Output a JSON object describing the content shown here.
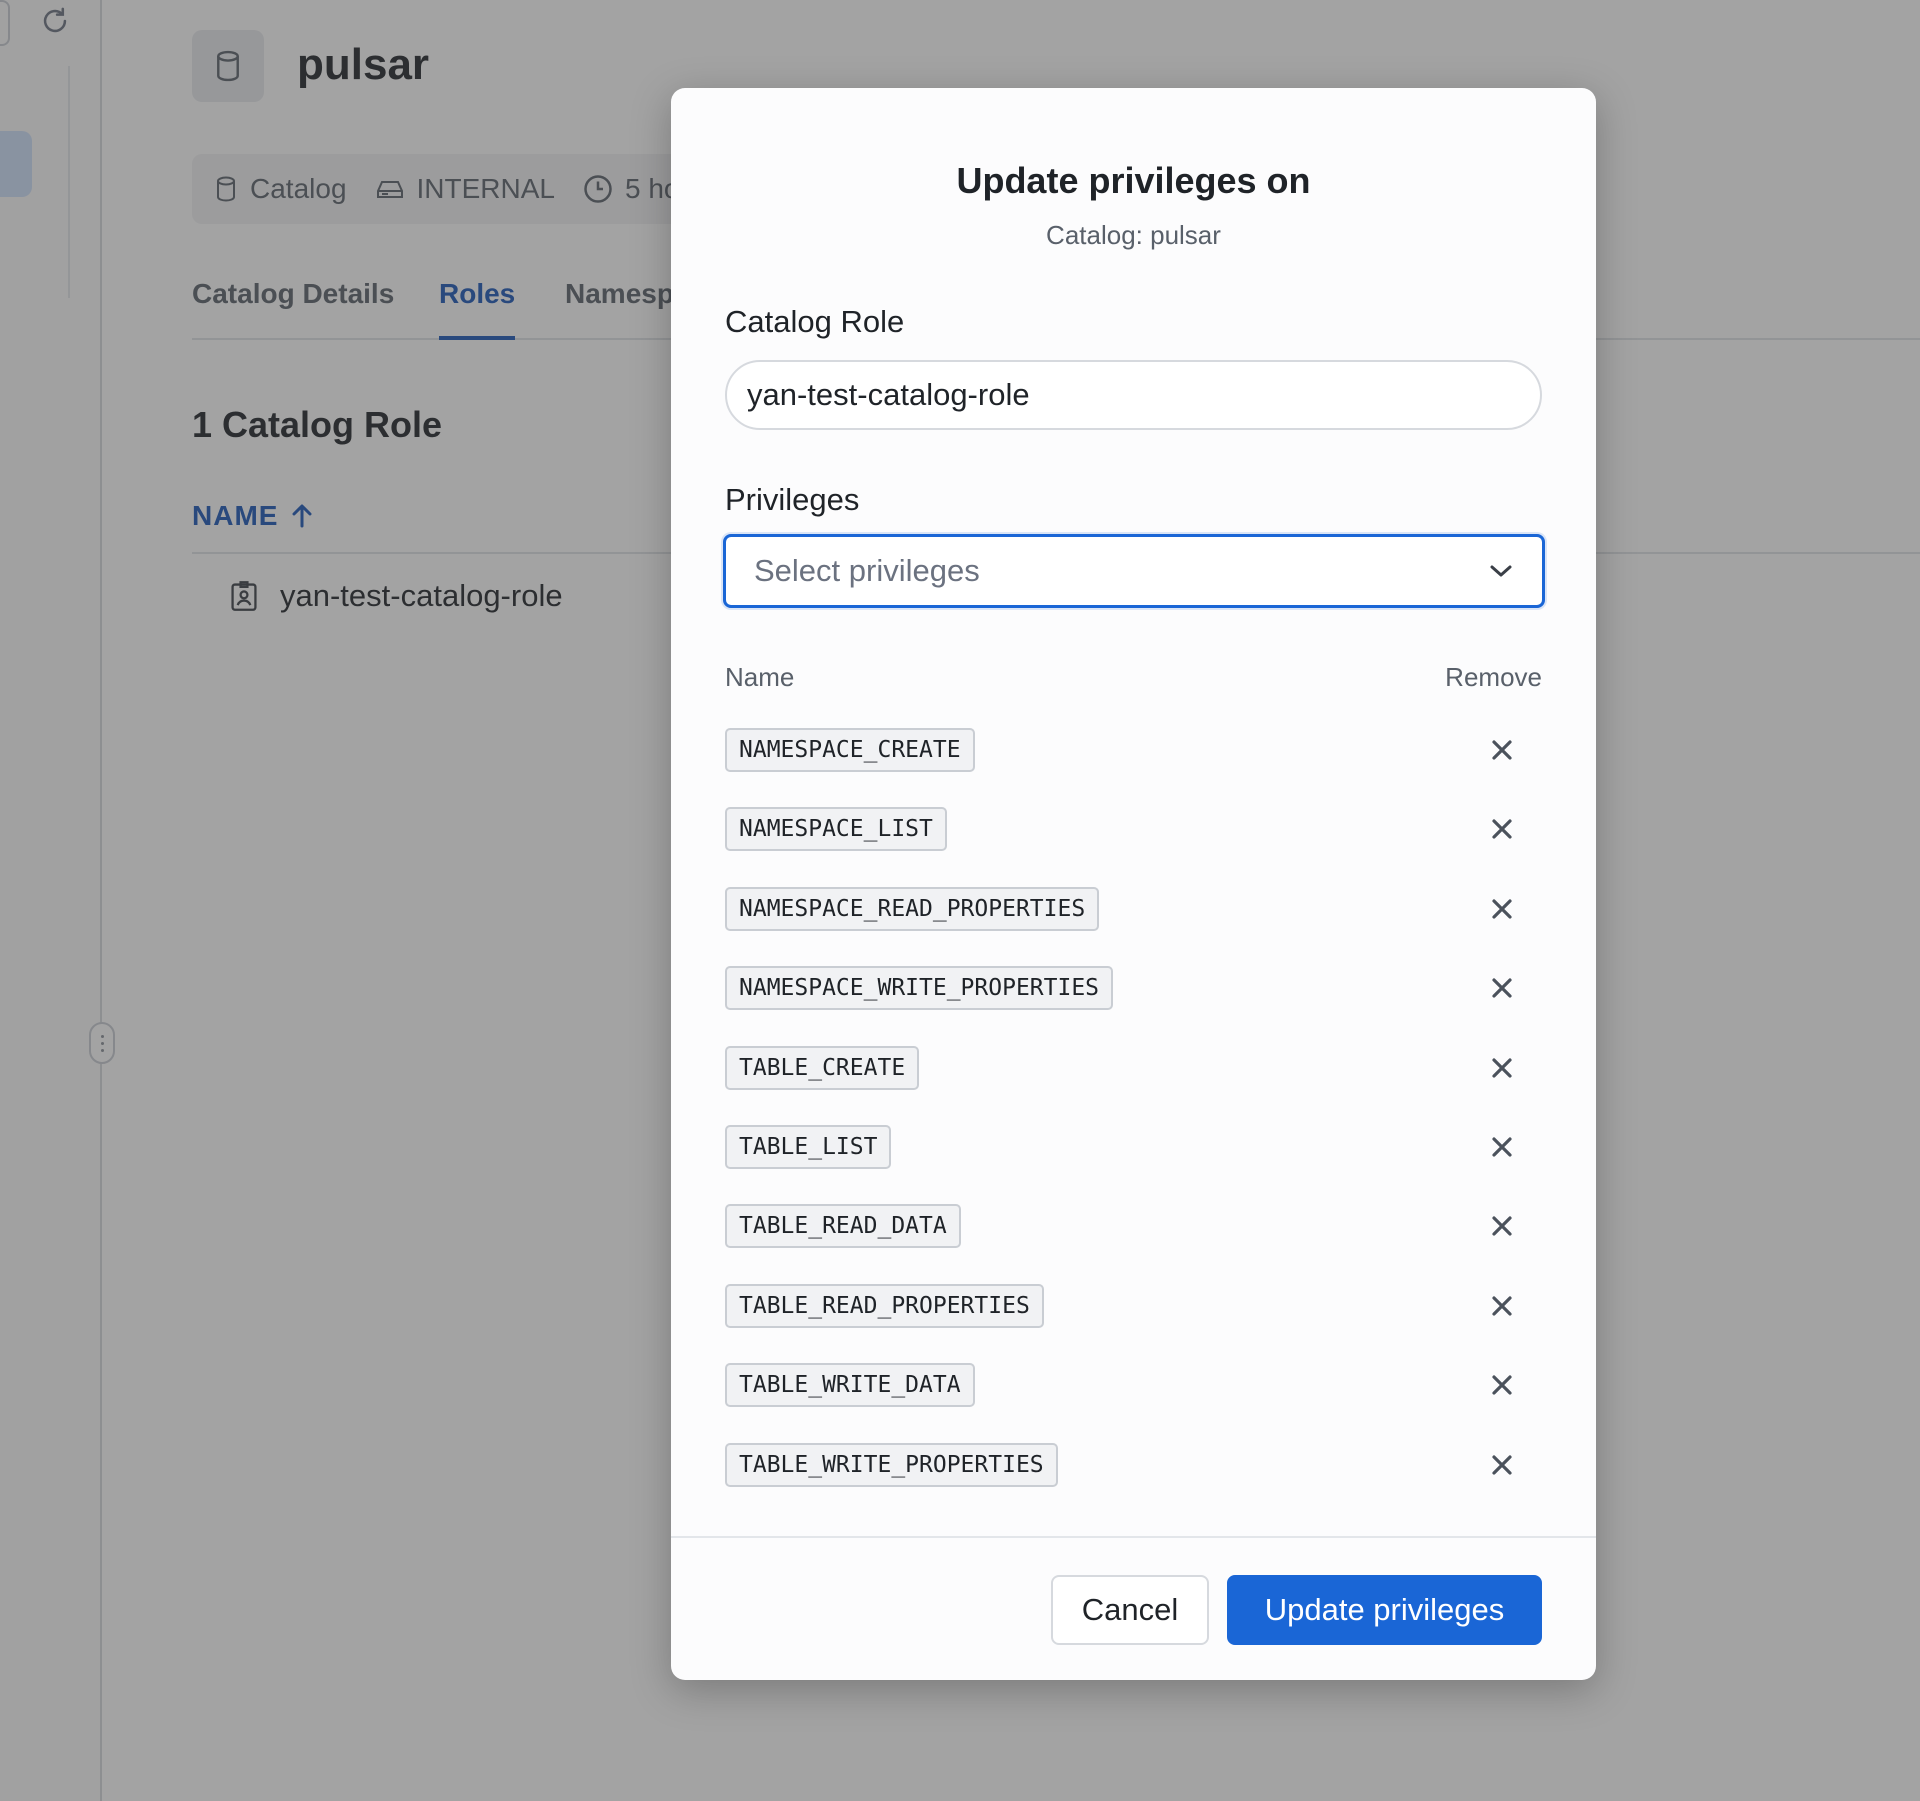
{
  "page": {
    "title": "pulsar",
    "meta": [
      {
        "icon": "database-icon",
        "label": "Catalog"
      },
      {
        "icon": "storage-icon",
        "label": "INTERNAL"
      },
      {
        "icon": "clock-icon",
        "label": "5 ho"
      }
    ],
    "tabs": [
      {
        "label": "Catalog Details",
        "active": false
      },
      {
        "label": "Roles",
        "active": true
      },
      {
        "label": "Namespa",
        "active": false
      }
    ],
    "section_title": "1 Catalog Role",
    "table": {
      "column_name": "NAME",
      "rows": [
        "yan-test-catalog-role"
      ]
    }
  },
  "modal": {
    "title": "Update privileges on",
    "subtitle": "Catalog: pulsar",
    "role_label": "Catalog Role",
    "role_value": "yan-test-catalog-role",
    "privileges_label": "Privileges",
    "privileges_placeholder": "Select privileges",
    "list_header_name": "Name",
    "list_header_remove": "Remove",
    "privileges": [
      "NAMESPACE_CREATE",
      "NAMESPACE_LIST",
      "NAMESPACE_READ_PROPERTIES",
      "NAMESPACE_WRITE_PROPERTIES",
      "TABLE_CREATE",
      "TABLE_LIST",
      "TABLE_READ_DATA",
      "TABLE_READ_PROPERTIES",
      "TABLE_WRITE_DATA",
      "TABLE_WRITE_PROPERTIES"
    ],
    "cancel_label": "Cancel",
    "submit_label": "Update privileges"
  },
  "colors": {
    "accent": "#1a66d6",
    "link": "#1a56b8",
    "overlay": "#3c3c3c"
  }
}
